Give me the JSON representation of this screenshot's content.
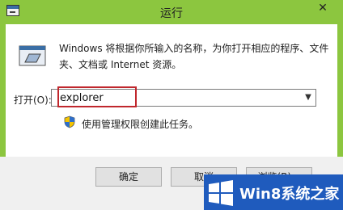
{
  "window": {
    "title": "运行",
    "close_label": "✕"
  },
  "description": {
    "text": "Windows 将根据你所输入的名称，为你打开相应的程序、文件夹、文档或 Internet 资源。"
  },
  "open": {
    "label": "打开(O):",
    "value": "explorer"
  },
  "admin_note": {
    "text": "使用管理权限创建此任务。"
  },
  "buttons": {
    "ok": "确定",
    "cancel": "取消",
    "browse": "浏览(B)..."
  },
  "watermark": {
    "text": "Win8系统之家"
  },
  "colors": {
    "frame": "#8cc63f",
    "highlight": "#c0272d",
    "watermark_bg": "#1f5bbd"
  },
  "icons": {
    "app": "run-icon",
    "shield": "shield-icon",
    "dropdown": "chevron-down-icon",
    "logo": "windows-logo-icon"
  }
}
